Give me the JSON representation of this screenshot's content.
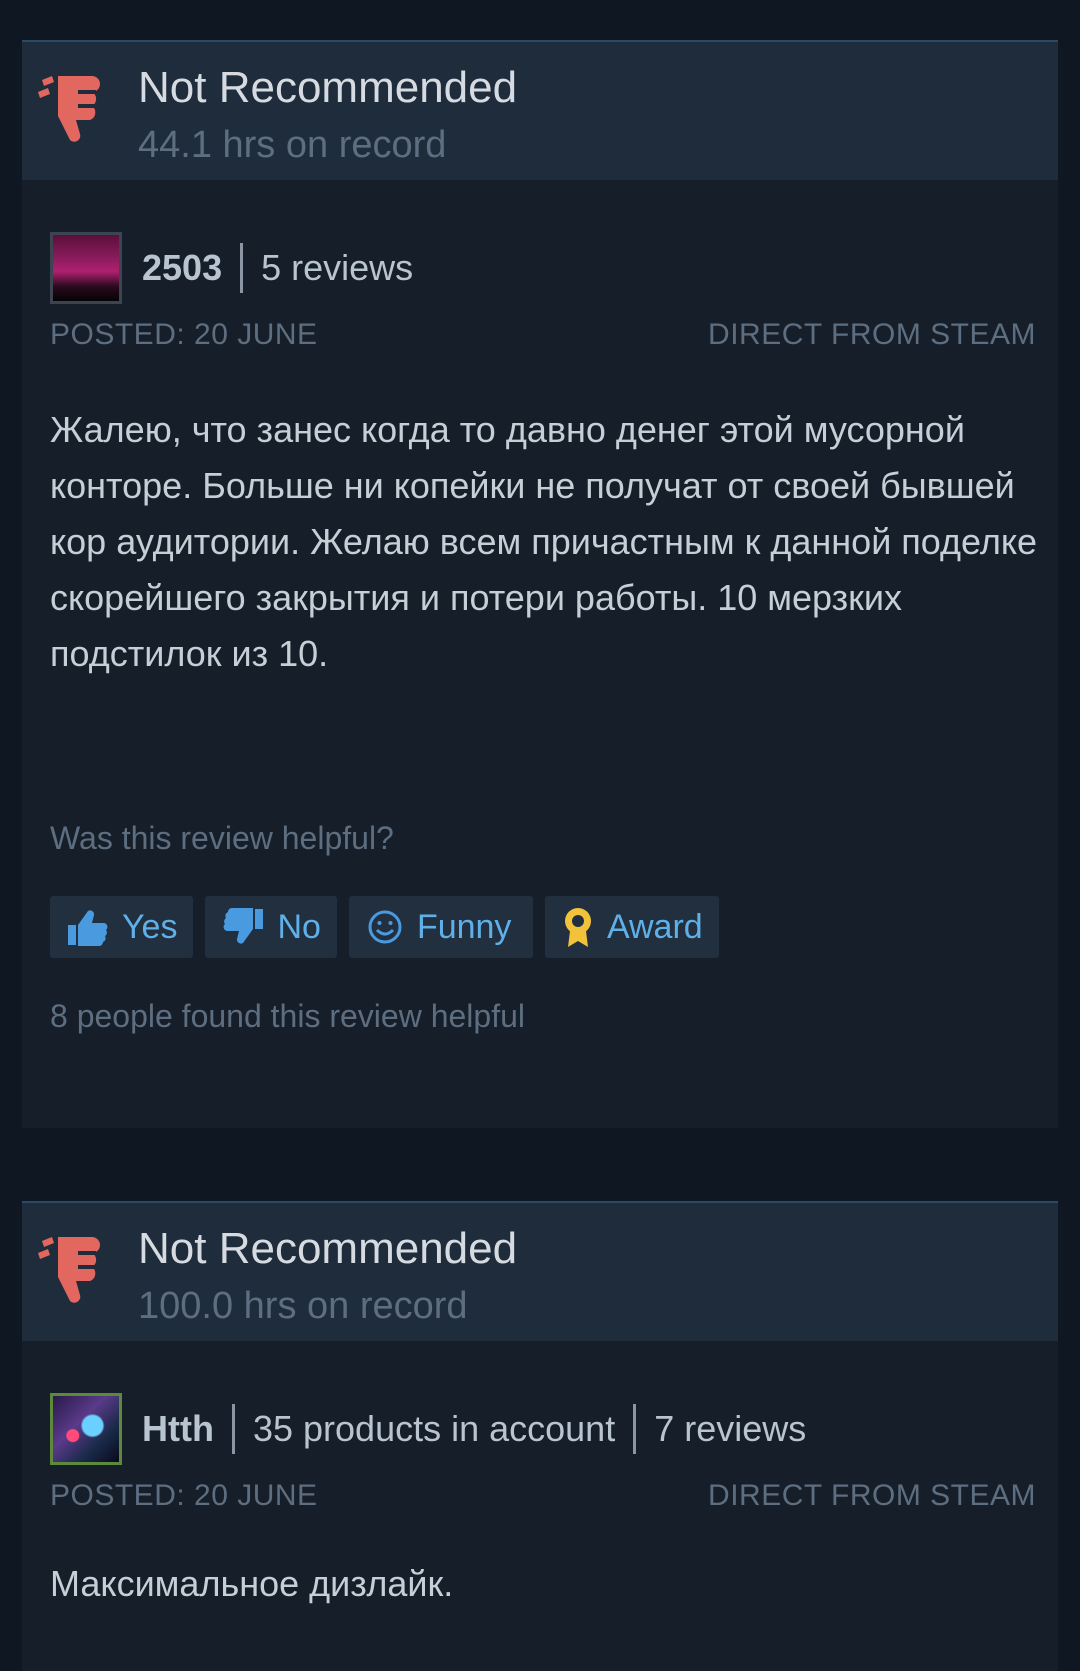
{
  "reviews": [
    {
      "verdict": "Not Recommended",
      "hours": "44.1 hrs on record",
      "author": "2503",
      "meta": [
        "5 reviews"
      ],
      "posted": "POSTED: 20 JUNE",
      "source": "DIRECT FROM STEAM",
      "text": "Жалею, что занес когда то давно денег этой мусорной конторе. Больше ни копейки не получат от своей бывшей кор аудитории. Желаю всем причастным к данной поделке скорейшего закрытия и потери работы. 10 мерзких подстилок из 10.",
      "helpful_question": "Was this review helpful?",
      "buttons": {
        "yes": "Yes",
        "no": "No",
        "funny": "Funny",
        "award": "Award"
      },
      "helpful_count": "8 people found this review helpful"
    },
    {
      "verdict": "Not Recommended",
      "hours": "100.0 hrs on record",
      "author": "Htth",
      "meta": [
        "35 products in account",
        "7 reviews"
      ],
      "posted": "POSTED: 20 JUNE",
      "source": "DIRECT FROM STEAM",
      "text": "Максимальное дизлайк."
    }
  ],
  "colors": {
    "page_bg": "#0f1723",
    "card_bg": "#161e29",
    "verdict_bg": "#1f2c3b",
    "thumb_down": "#e2675f",
    "link_blue": "#5fb0e8",
    "award_gold": "#f2c23a"
  },
  "icons": {
    "verdict": "thumbs-down-icon",
    "yes": "thumbs-up-icon",
    "no": "thumbs-down-icon",
    "funny": "smiley-icon",
    "award": "award-ribbon-icon"
  }
}
